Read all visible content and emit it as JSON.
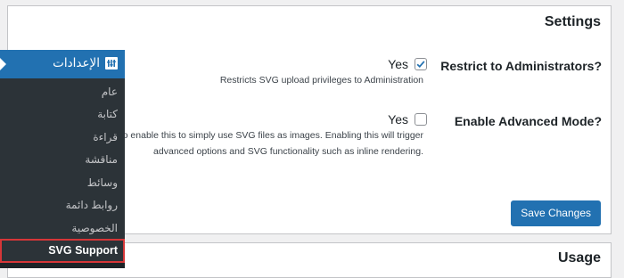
{
  "settings": {
    "title": "Settings",
    "restrict": {
      "label": "Restrict to Administrators?",
      "checkbox_label": "Yes",
      "checked": true,
      "description": "Restricts SVG upload privileges to Administration"
    },
    "advanced": {
      "label": "Enable Advanced Mode?",
      "checkbox_label": "Yes",
      "checked": false,
      "description_line1": "to enable this to simply use SVG files as images. Enabling this will trigger",
      "description_line2": "advanced options and SVG functionality such as inline rendering."
    },
    "save_label": "Save Changes"
  },
  "usage": {
    "title": "Usage"
  },
  "sidebar": {
    "head_label": "الإعدادات",
    "items": [
      {
        "label": "عام"
      },
      {
        "label": "كتابة"
      },
      {
        "label": "قراءة"
      },
      {
        "label": "مناقشة"
      },
      {
        "label": "وسائط"
      },
      {
        "label": "روابط دائمة"
      },
      {
        "label": "الخصوصية"
      }
    ],
    "active_item": "SVG Support"
  },
  "colors": {
    "accent": "#2271b1",
    "sidebar_bg": "#2c3338",
    "highlight_border": "#d63638"
  }
}
